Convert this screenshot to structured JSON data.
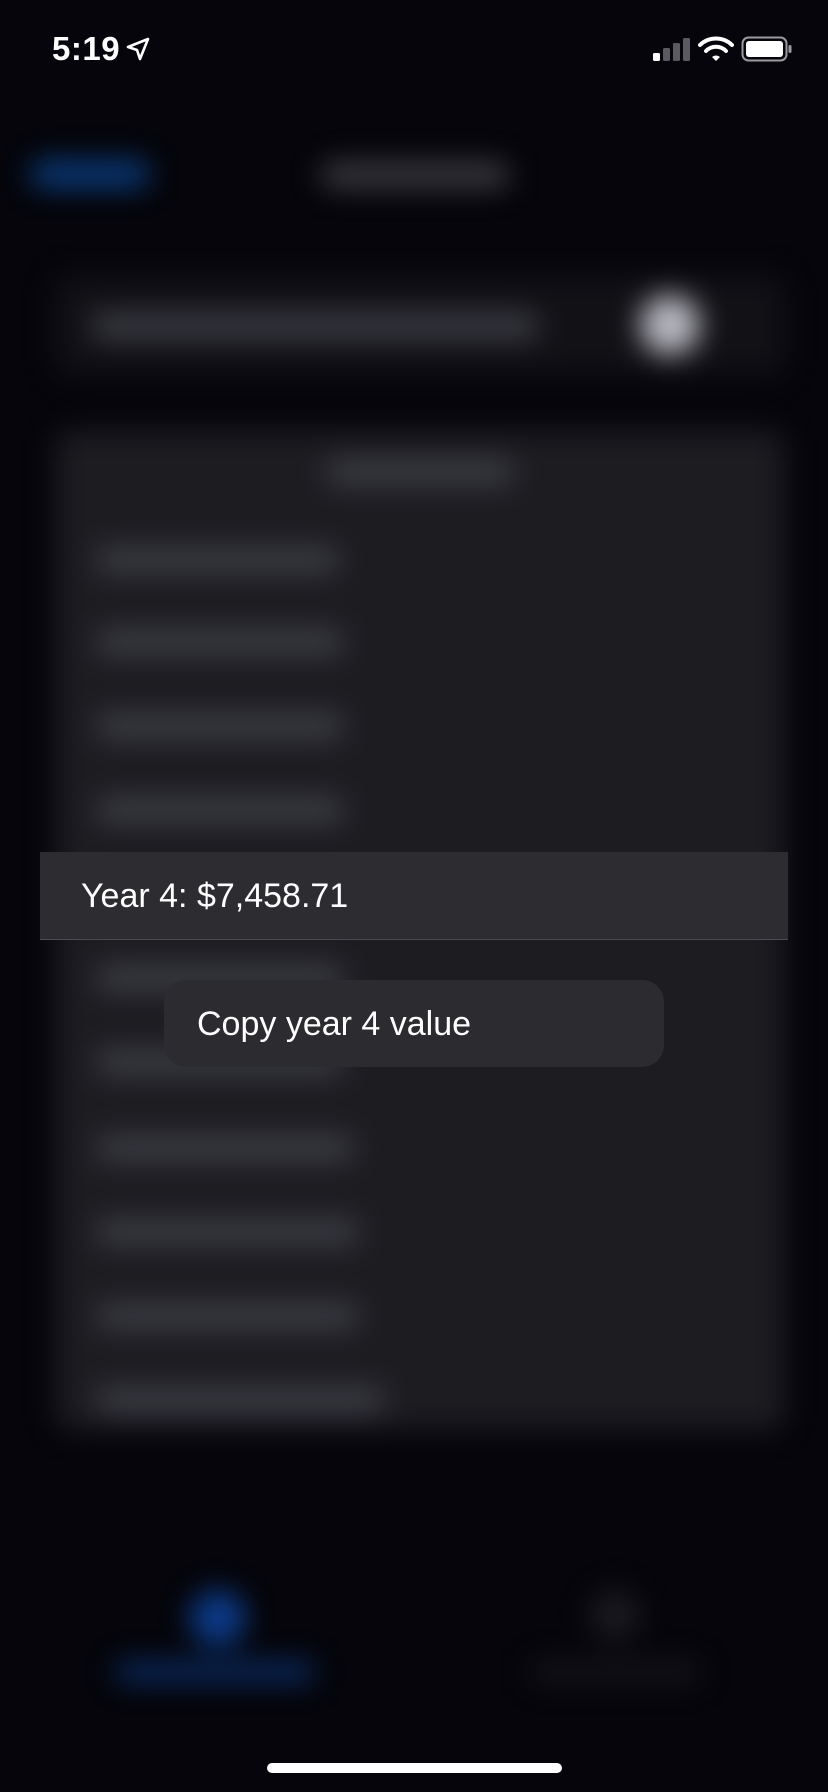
{
  "status_bar": {
    "time": "5:19",
    "location_icon": "location-arrow-icon",
    "signal_icon": "cellular-signal-icon",
    "wifi_icon": "wifi-icon",
    "battery_icon": "battery-icon",
    "text_color": "#ffffff"
  },
  "focused_row": {
    "label": "Year 4: $7,458.71",
    "background": "#2d2d31"
  },
  "context_menu": {
    "items": [
      {
        "label": "Copy year 4 value"
      }
    ],
    "background": "#2c2c30"
  },
  "colors": {
    "screen_background": "#05050b",
    "blurred_accent": "#0c3b8a"
  }
}
